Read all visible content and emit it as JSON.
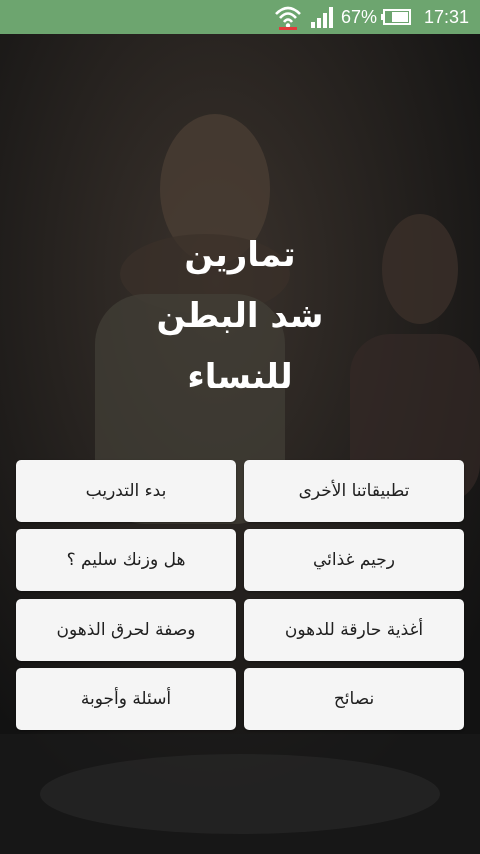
{
  "status_bar": {
    "battery_percent": "67%",
    "time": "17:31",
    "icons": [
      "wifi-icon",
      "signal-icon",
      "battery-icon"
    ]
  },
  "title": {
    "lines": [
      "تمارين",
      "شد البطن",
      "للنساء"
    ]
  },
  "menu": {
    "buttons": [
      {
        "label": "تطبيقاتنا الأخرى"
      },
      {
        "label": "بدء التدريب"
      },
      {
        "label": "رجيم غذائي"
      },
      {
        "label": "هل وزنك سليم ؟"
      },
      {
        "label": "أغذية حارقة للدهون"
      },
      {
        "label": "وصفة لحرق الذهون"
      },
      {
        "label": "نصائح"
      },
      {
        "label": "أسئلة وأجوبة"
      }
    ]
  },
  "colors": {
    "status_bar": "#6da56f",
    "button_bg": "#f5f5f5",
    "overlay": "#151515"
  }
}
